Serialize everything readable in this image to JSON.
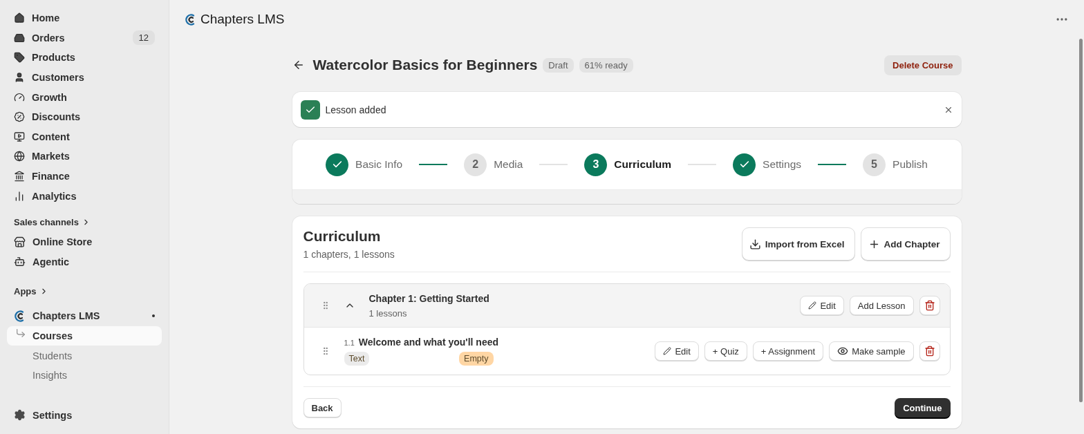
{
  "sidebar": {
    "items": [
      {
        "label": "Home",
        "selected": false
      },
      {
        "label": "Orders",
        "selected": false,
        "badge": "12"
      },
      {
        "label": "Products",
        "selected": false
      },
      {
        "label": "Customers",
        "selected": false
      },
      {
        "label": "Growth",
        "selected": false
      },
      {
        "label": "Discounts",
        "selected": false
      },
      {
        "label": "Content",
        "selected": false
      },
      {
        "label": "Markets",
        "selected": false
      },
      {
        "label": "Finance",
        "selected": false
      },
      {
        "label": "Analytics",
        "selected": false
      }
    ],
    "sales_channels": {
      "title": "Sales channels",
      "items": [
        {
          "label": "Online Store",
          "selected": false
        },
        {
          "label": "Agentic",
          "selected": false
        }
      ]
    },
    "apps": {
      "title": "Apps",
      "app": {
        "label": "Chapters LMS",
        "items": [
          {
            "label": "Courses",
            "selected": true
          },
          {
            "label": "Students",
            "selected": false
          },
          {
            "label": "Insights",
            "selected": false
          }
        ]
      }
    },
    "settings": "Settings"
  },
  "topbar": {
    "title": "Chapters LMS"
  },
  "course": {
    "title": "Watercolor Basics for Beginners",
    "badges": [
      "Draft",
      "61% ready"
    ],
    "delete_button": "Delete Course"
  },
  "toast": {
    "message": "Lesson added"
  },
  "steps": [
    {
      "label": "Basic Info",
      "completed": true,
      "selected": false
    },
    {
      "label": "Media",
      "number": "2",
      "completed": false,
      "selected": false
    },
    {
      "label": "Curriculum",
      "number": "3",
      "completed": false,
      "selected": true
    },
    {
      "label": "Settings",
      "completed": true,
      "selected": false
    },
    {
      "label": "Publish",
      "number": "5",
      "completed": false,
      "selected": false
    }
  ],
  "curriculum": {
    "title": "Curriculum",
    "summary": "1 chapters, 1 lessons",
    "buttons": [
      {
        "kind": "import",
        "label": "Import from Excel"
      },
      {
        "kind": "add",
        "label": "Add Chapter"
      }
    ],
    "chapters": [
      {
        "title": "Chapter 1: Getting Started",
        "count": "1 lessons",
        "expanded": true,
        "buttons": [
          {
            "kind": "edit",
            "label": "Edit"
          },
          {
            "kind": "plain",
            "label": "Add Lesson"
          },
          {
            "kind": "delete"
          }
        ],
        "lessons": [
          {
            "number": "1.1",
            "title": "Welcome and what you'll need",
            "tags": [
              {
                "label": "Text",
                "color": "#ebebeb"
              },
              {
                "label": "Empty",
                "color": "#ffd6a4"
              }
            ],
            "buttons": [
              {
                "kind": "edit",
                "label": "Edit"
              },
              {
                "kind": "plain",
                "label": "+ Quiz"
              },
              {
                "kind": "plain",
                "label": "+ Assignment"
              },
              {
                "kind": "eye",
                "label": "Make sample"
              },
              {
                "kind": "delete"
              }
            ]
          }
        ]
      }
    ],
    "back_button": "Back",
    "continue_button": "Continue"
  }
}
